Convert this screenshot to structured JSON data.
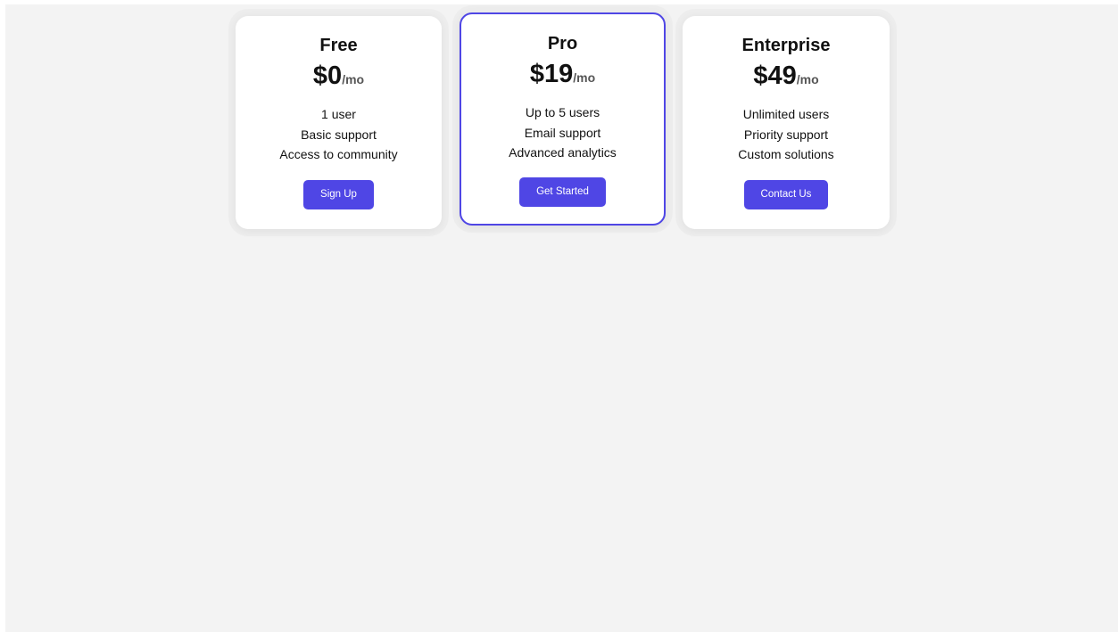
{
  "plans": [
    {
      "name": "Free",
      "price": "$0",
      "unit": "/mo",
      "features": [
        "1 user",
        "Basic support",
        "Access to community"
      ],
      "cta": "Sign Up"
    },
    {
      "name": "Pro",
      "price": "$19",
      "unit": "/mo",
      "features": [
        "Up to 5 users",
        "Email support",
        "Advanced analytics"
      ],
      "cta": "Get Started",
      "featured": true
    },
    {
      "name": "Enterprise",
      "price": "$49",
      "unit": "/mo",
      "features": [
        "Unlimited users",
        "Priority support",
        "Custom solutions"
      ],
      "cta": "Contact Us"
    }
  ],
  "colors": {
    "accent": "#4f46e5",
    "background": "#f3f3f3",
    "card": "#ffffff"
  }
}
